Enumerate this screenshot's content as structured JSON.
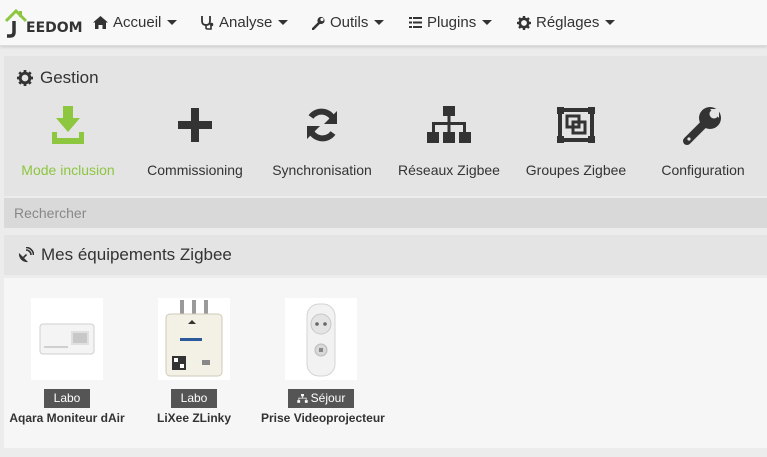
{
  "app": {
    "logo_text": "EEDOM"
  },
  "navbar": {
    "items": [
      {
        "label": "Accueil",
        "icon": "home-icon"
      },
      {
        "label": "Analyse",
        "icon": "stethoscope-icon"
      },
      {
        "label": "Outils",
        "icon": "wrench-icon"
      },
      {
        "label": "Plugins",
        "icon": "tasks-icon"
      },
      {
        "label": "Réglages",
        "icon": "cogs-icon"
      }
    ]
  },
  "gestion": {
    "title": "Gestion",
    "actions": [
      {
        "label": "Mode inclusion",
        "icon": "download-icon",
        "color": "#8dc63f"
      },
      {
        "label": "Commissioning",
        "icon": "plus-icon"
      },
      {
        "label": "Synchronisation",
        "icon": "sync-icon"
      },
      {
        "label": "Réseaux Zigbee",
        "icon": "sitemap-icon"
      },
      {
        "label": "Groupes Zigbee",
        "icon": "object-group-icon"
      },
      {
        "label": "Configuration",
        "icon": "wrench-icon"
      }
    ]
  },
  "search": {
    "placeholder": "Rechercher",
    "value": ""
  },
  "equipements": {
    "title": "Mes équipements Zigbee",
    "items": [
      {
        "name": "Aqara Moniteur dAir",
        "room": "Labo"
      },
      {
        "name": "LiXee ZLinky",
        "room": "Labo"
      },
      {
        "name": "Prise Videoprojecteur",
        "room": "Séjour",
        "room_icon": "sitemap-icon"
      }
    ]
  },
  "colors": {
    "accent": "#8dc63f",
    "badge": "#555555"
  }
}
